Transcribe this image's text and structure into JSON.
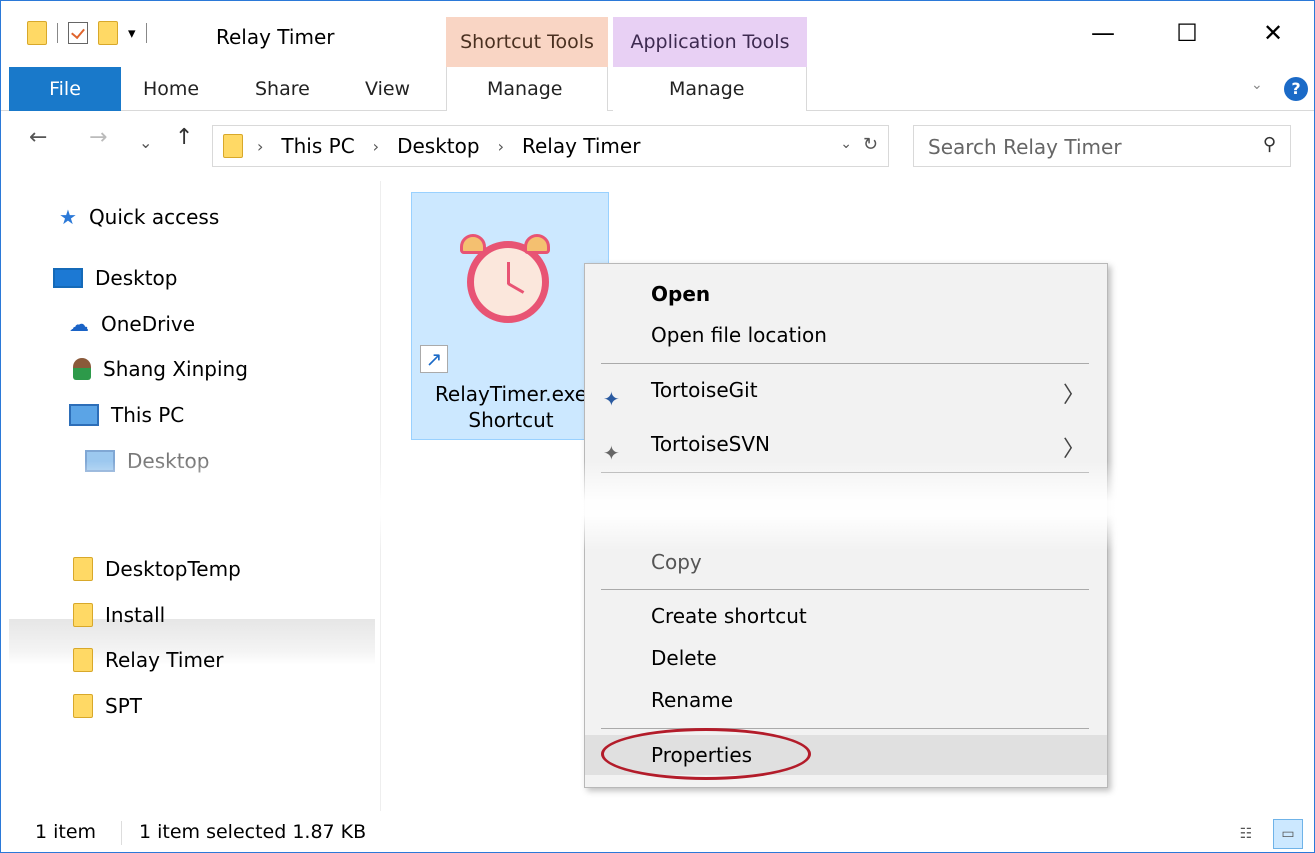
{
  "window": {
    "title": "Relay Timer",
    "minimize": "—",
    "maximize": "☐",
    "close": "✕"
  },
  "qat": {
    "dropdown": "▾"
  },
  "ribbon": {
    "tabs": {
      "file": "File",
      "home": "Home",
      "share": "Share",
      "view": "View"
    },
    "shortcut_tools": "Shortcut Tools",
    "application_tools": "Application Tools",
    "manage1": "Manage",
    "manage2": "Manage",
    "collapse": "⌄",
    "help": "?"
  },
  "nav": {
    "back": "←",
    "forward": "→",
    "recent": "⌄",
    "up": "↑"
  },
  "address": {
    "crumbs": [
      "This PC",
      "Desktop",
      "Relay Timer"
    ],
    "chevron": "›",
    "dropdown": "⌄",
    "refresh": "↻"
  },
  "search": {
    "placeholder": "Search Relay Timer",
    "icon": "⚲"
  },
  "navpane": {
    "quick_access": "Quick access",
    "desktop": "Desktop",
    "onedrive": "OneDrive",
    "user": "Shang Xinping",
    "this_pc": "This PC",
    "desktop_sub": "Desktop",
    "folders": [
      "DesktopTemp",
      "Install",
      "Relay Timer",
      "SPT"
    ]
  },
  "file": {
    "name_line1": "RelayTimer.exe",
    "name_line2": "Shortcut"
  },
  "context_menu": {
    "open": "Open",
    "open_location": "Open file location",
    "tortoisegit": "TortoiseGit",
    "tortoisesvn": "TortoiseSVN",
    "copy": "Copy",
    "create_shortcut": "Create shortcut",
    "delete": "Delete",
    "rename": "Rename",
    "properties": "Properties",
    "submenu_arrow": "〉"
  },
  "status": {
    "items": "1 item",
    "selected": "1 item selected  1.87 KB"
  }
}
